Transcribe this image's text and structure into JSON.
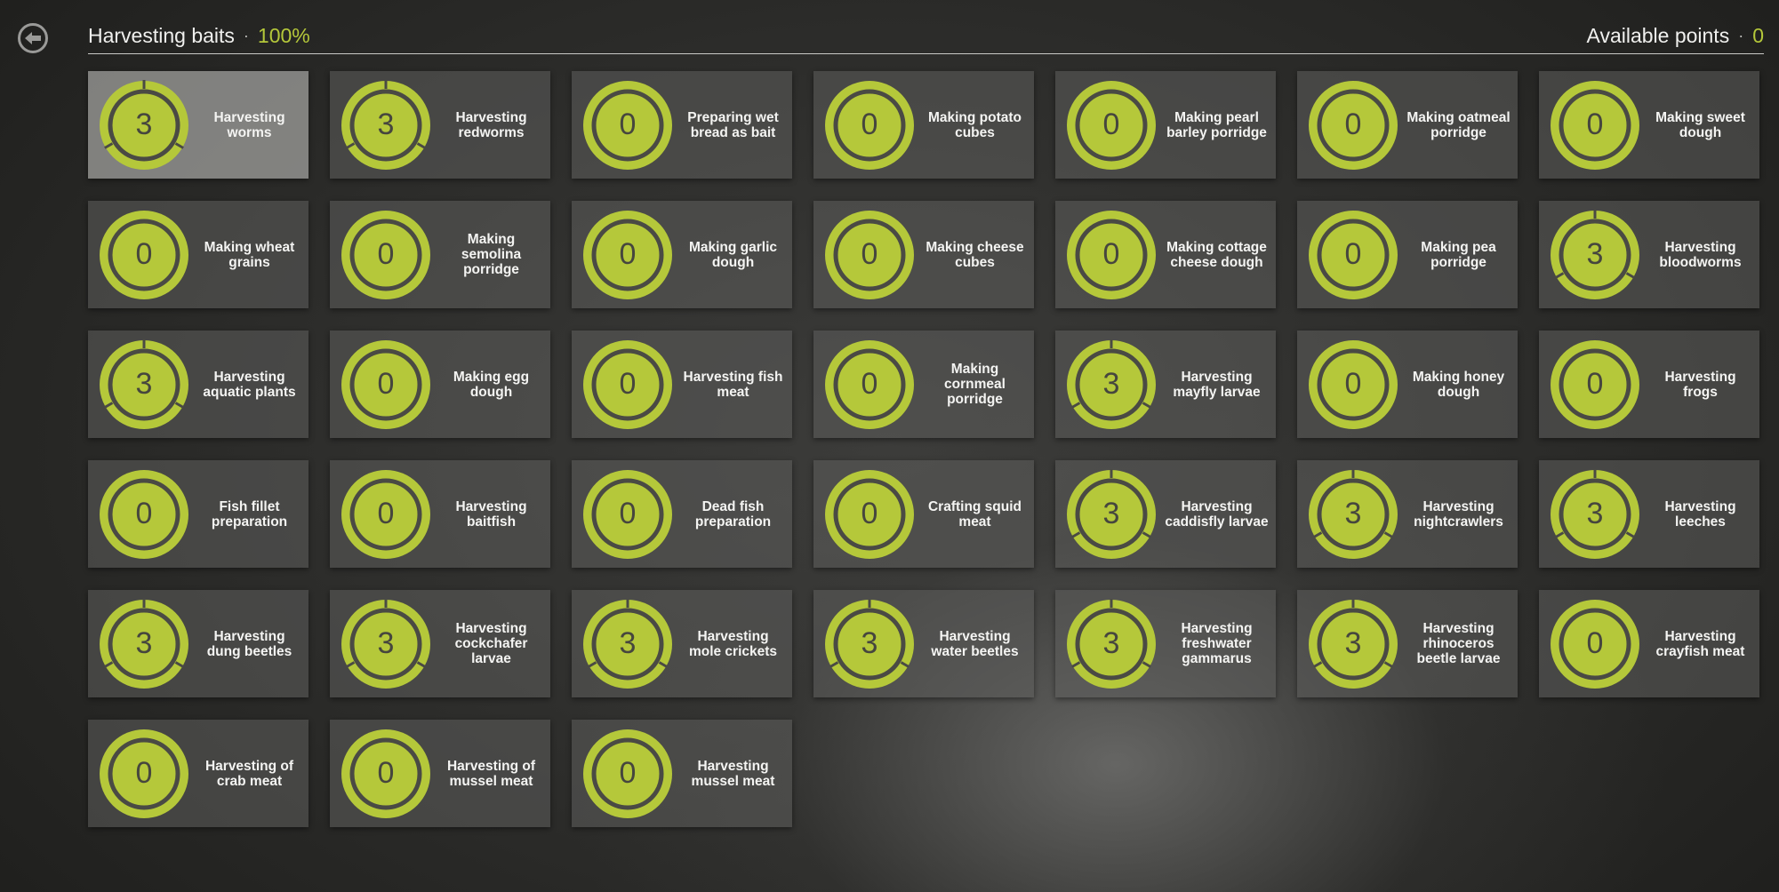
{
  "header": {
    "title": "Harvesting baits",
    "progress": "100%",
    "points_label": "Available points",
    "points_value": "0"
  },
  "colors": {
    "accent": "#b5c83a",
    "ring_dark": "#4a4a44",
    "card": "#5f5f5d"
  },
  "icons": {
    "back": "back-arrow-icon"
  },
  "skills": [
    {
      "label": "Harvesting worms",
      "value": "3",
      "segmented": true
    },
    {
      "label": "Harvesting redworms",
      "value": "3",
      "segmented": true
    },
    {
      "label": "Preparing wet bread as bait",
      "value": "0",
      "segmented": false
    },
    {
      "label": "Making potato cubes",
      "value": "0",
      "segmented": false
    },
    {
      "label": "Making pearl barley porridge",
      "value": "0",
      "segmented": false
    },
    {
      "label": "Making oatmeal porridge",
      "value": "0",
      "segmented": false
    },
    {
      "label": "Making sweet dough",
      "value": "0",
      "segmented": false
    },
    {
      "label": "Making wheat grains",
      "value": "0",
      "segmented": false
    },
    {
      "label": "Making semolina porridge",
      "value": "0",
      "segmented": false
    },
    {
      "label": "Making garlic dough",
      "value": "0",
      "segmented": false
    },
    {
      "label": "Making cheese cubes",
      "value": "0",
      "segmented": false
    },
    {
      "label": "Making cottage cheese dough",
      "value": "0",
      "segmented": false
    },
    {
      "label": "Making pea porridge",
      "value": "0",
      "segmented": false
    },
    {
      "label": "Harvesting bloodworms",
      "value": "3",
      "segmented": true
    },
    {
      "label": "Harvesting aquatic plants",
      "value": "3",
      "segmented": true
    },
    {
      "label": "Making egg dough",
      "value": "0",
      "segmented": false
    },
    {
      "label": "Harvesting fish meat",
      "value": "0",
      "segmented": false
    },
    {
      "label": "Making cornmeal porridge",
      "value": "0",
      "segmented": false
    },
    {
      "label": "Harvesting mayfly larvae",
      "value": "3",
      "segmented": true
    },
    {
      "label": "Making honey dough",
      "value": "0",
      "segmented": false
    },
    {
      "label": "Harvesting frogs",
      "value": "0",
      "segmented": false
    },
    {
      "label": "Fish fillet preparation",
      "value": "0",
      "segmented": false
    },
    {
      "label": "Harvesting baitfish",
      "value": "0",
      "segmented": false
    },
    {
      "label": "Dead fish preparation",
      "value": "0",
      "segmented": false
    },
    {
      "label": "Crafting squid meat",
      "value": "0",
      "segmented": false
    },
    {
      "label": "Harvesting caddisfly larvae",
      "value": "3",
      "segmented": true
    },
    {
      "label": "Harvesting nightcrawlers",
      "value": "3",
      "segmented": true
    },
    {
      "label": "Harvesting leeches",
      "value": "3",
      "segmented": true
    },
    {
      "label": "Harvesting dung beetles",
      "value": "3",
      "segmented": true
    },
    {
      "label": "Harvesting cockchafer larvae",
      "value": "3",
      "segmented": true
    },
    {
      "label": "Harvesting mole crickets",
      "value": "3",
      "segmented": true
    },
    {
      "label": "Harvesting water beetles",
      "value": "3",
      "segmented": true
    },
    {
      "label": "Harvesting freshwater gammarus",
      "value": "3",
      "segmented": true
    },
    {
      "label": "Harvesting rhinoceros beetle larvae",
      "value": "3",
      "segmented": true
    },
    {
      "label": "Harvesting crayfish meat",
      "value": "0",
      "segmented": false
    },
    {
      "label": "Harvesting of crab meat",
      "value": "0",
      "segmented": false
    },
    {
      "label": "Harvesting of mussel meat",
      "value": "0",
      "segmented": false
    },
    {
      "label": "Harvesting mussel meat",
      "value": "0",
      "segmented": false
    }
  ]
}
